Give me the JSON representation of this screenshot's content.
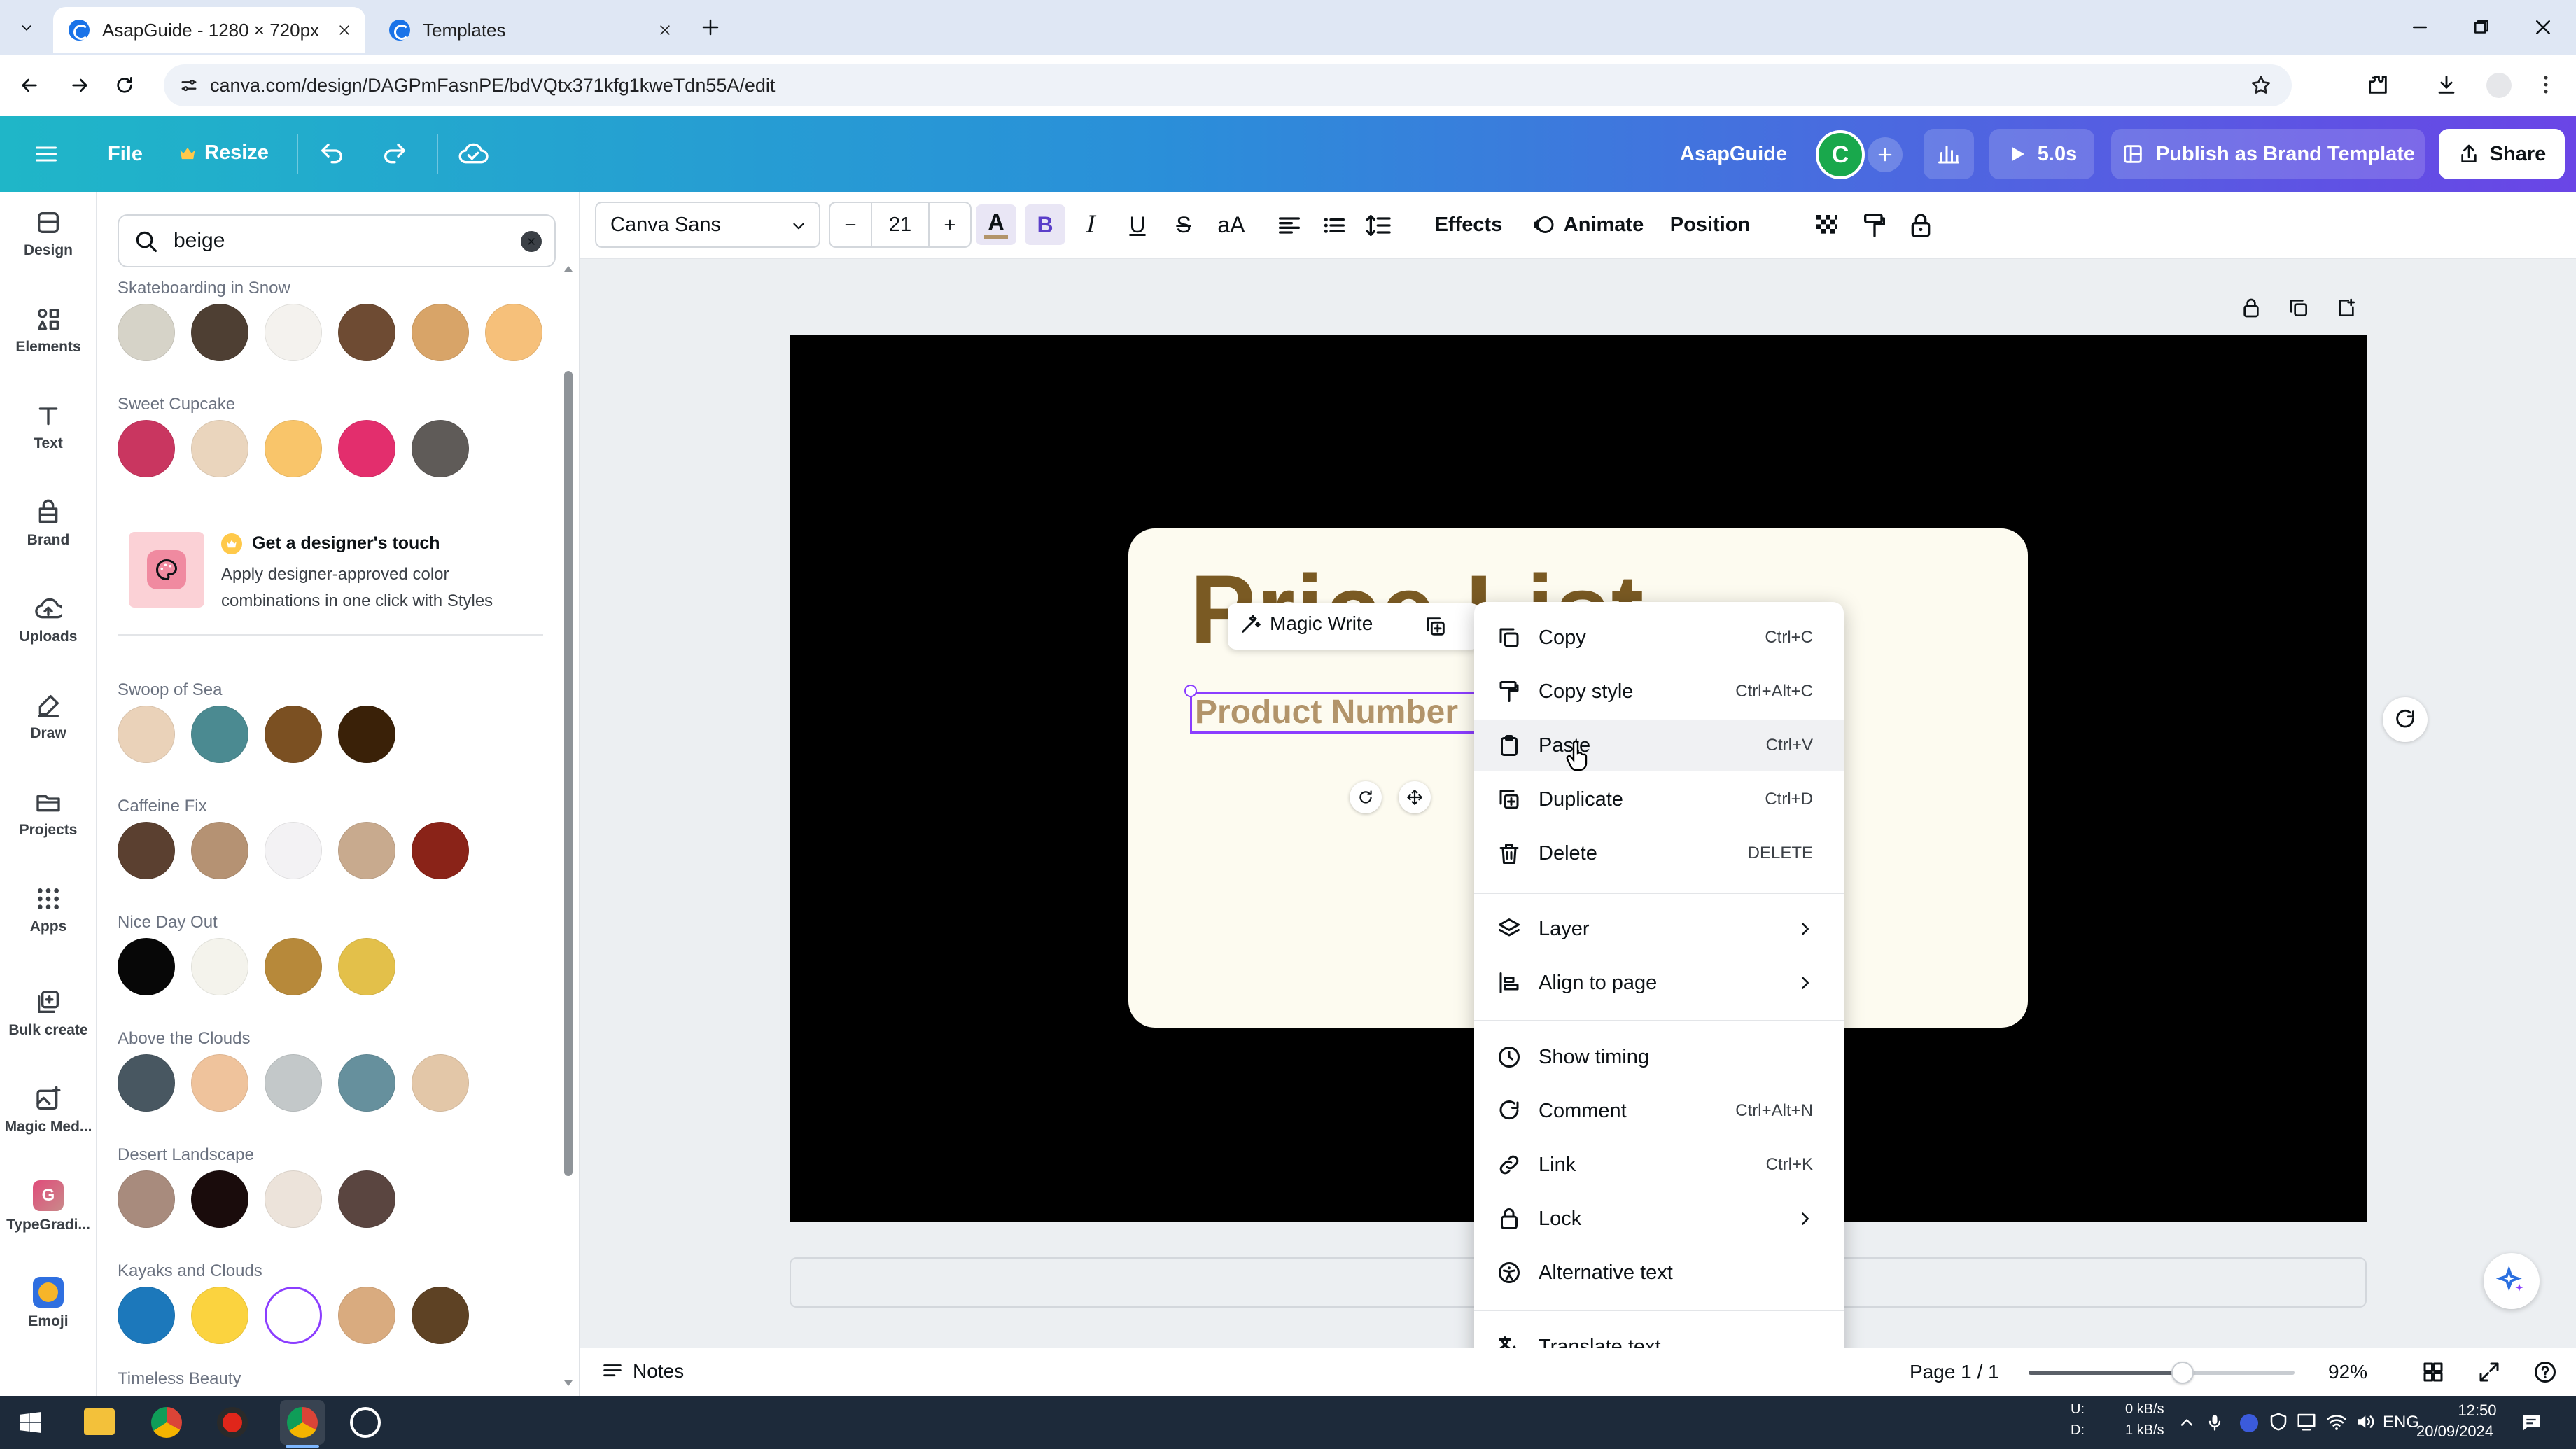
{
  "browser": {
    "tabs": [
      {
        "title": "AsapGuide - 1280 × 720px",
        "active": true
      },
      {
        "title": "Templates",
        "active": false
      }
    ],
    "url": "canva.com/design/DAGPmFasnPE/bdVQtx371kfg1kweTdn55A/edit"
  },
  "topbar": {
    "file": "File",
    "resize": "Resize",
    "design_name": "AsapGuide",
    "avatar_letter": "C",
    "play_time": "5.0s",
    "publish": "Publish as Brand Template",
    "share": "Share"
  },
  "rail": [
    {
      "label": "Design",
      "icon": "design-icon"
    },
    {
      "label": "Elements",
      "icon": "elements-icon"
    },
    {
      "label": "Text",
      "icon": "text-icon"
    },
    {
      "label": "Brand",
      "icon": "brand-icon"
    },
    {
      "label": "Uploads",
      "icon": "uploads-icon"
    },
    {
      "label": "Draw",
      "icon": "draw-icon"
    },
    {
      "label": "Projects",
      "icon": "projects-icon"
    },
    {
      "label": "Apps",
      "icon": "apps-icon"
    },
    {
      "label": "Bulk create",
      "icon": "bulk-create-icon"
    },
    {
      "label": "Magic Med...",
      "icon": "magic-media-icon"
    },
    {
      "label": "TypeGradi...",
      "icon": "typegradient-icon"
    },
    {
      "label": "Emoji",
      "icon": "emoji-icon"
    }
  ],
  "panel": {
    "search_value": "beige",
    "palettes": [
      {
        "name": "Skateboarding in Snow",
        "colors": [
          "#d6d3c8",
          "#4e3f33",
          "#f4f2ee",
          "#6e4b33",
          "#d8a468",
          "#f6c07a"
        ]
      },
      {
        "name": "Sweet Cupcake",
        "colors": [
          "#c93660",
          "#ead5bd",
          "#f9c56a",
          "#e32e6d",
          "#5f5b58"
        ]
      },
      {
        "name": "Swoop of Sea",
        "colors": [
          "#ead2b9",
          "#4b8a91",
          "#7b5022",
          "#3a2108"
        ]
      },
      {
        "name": "Caffeine Fix",
        "colors": [
          "#5b4030",
          "#b59273",
          "#f3f2f4",
          "#c8aa8e",
          "#8a2318"
        ]
      },
      {
        "name": "Nice Day Out",
        "colors": [
          "#070707",
          "#f4f3ec",
          "#b7893a",
          "#e3c04a"
        ]
      },
      {
        "name": "Above the Clouds",
        "colors": [
          "#485761",
          "#efc39c",
          "#c3c8c9",
          "#66909d",
          "#e3c7a8"
        ]
      },
      {
        "name": "Desert Landscape",
        "colors": [
          "#a88b7d",
          "#1a0c0c",
          "#ece3da",
          "#5a4540"
        ]
      },
      {
        "name": "Kayaks and Clouds",
        "colors": [
          "#1c78bb",
          "#fbd33f",
          "#ffffff",
          "#d9ab7f",
          "#5e4224"
        ]
      }
    ],
    "designer_touch": {
      "title": "Get a designer's touch",
      "body": "Apply designer-approved color combinations in one click with Styles"
    },
    "last_palette_name": "Timeless Beauty"
  },
  "toolbar": {
    "font": "Canva Sans",
    "font_size": "21",
    "effects": "Effects",
    "animate": "Animate",
    "position": "Position"
  },
  "canvas": {
    "title_text": "Price List",
    "product_text": "Product Number",
    "magic_write": "Magic Write"
  },
  "context_menu": [
    {
      "label": "Copy",
      "shortcut": "Ctrl+C",
      "icon": "copy-icon"
    },
    {
      "label": "Copy style",
      "shortcut": "Ctrl+Alt+C",
      "icon": "paint-roller-icon"
    },
    {
      "label": "Paste",
      "shortcut": "Ctrl+V",
      "icon": "clipboard-icon"
    },
    {
      "label": "Duplicate",
      "shortcut": "Ctrl+D",
      "icon": "duplicate-icon"
    },
    {
      "label": "Delete",
      "shortcut": "DELETE",
      "icon": "trash-icon"
    },
    {
      "label": "Layer",
      "shortcut": "",
      "icon": "layers-icon"
    },
    {
      "label": "Align to page",
      "shortcut": "",
      "icon": "align-icon"
    },
    {
      "label": "Show timing",
      "shortcut": "",
      "icon": "clock-icon"
    },
    {
      "label": "Comment",
      "shortcut": "Ctrl+Alt+N",
      "icon": "comment-icon"
    },
    {
      "label": "Link",
      "shortcut": "Ctrl+K",
      "icon": "link-icon"
    },
    {
      "label": "Lock",
      "shortcut": "",
      "icon": "lock-icon"
    },
    {
      "label": "Alternative text",
      "shortcut": "",
      "icon": "accessibility-icon"
    },
    {
      "label": "Translate text",
      "shortcut": "",
      "icon": "translate-icon"
    }
  ],
  "bottombar": {
    "notes": "Notes",
    "page": "Page 1 / 1",
    "zoom": "92%",
    "zoom_fraction": 0.58
  },
  "taskbar": {
    "net_up_label": "U:",
    "net_down_label": "D:",
    "net_up": "0 kB/s",
    "net_down": "1 kB/s",
    "lang": "ENG",
    "time": "12:50",
    "date": "20/09/2024"
  }
}
